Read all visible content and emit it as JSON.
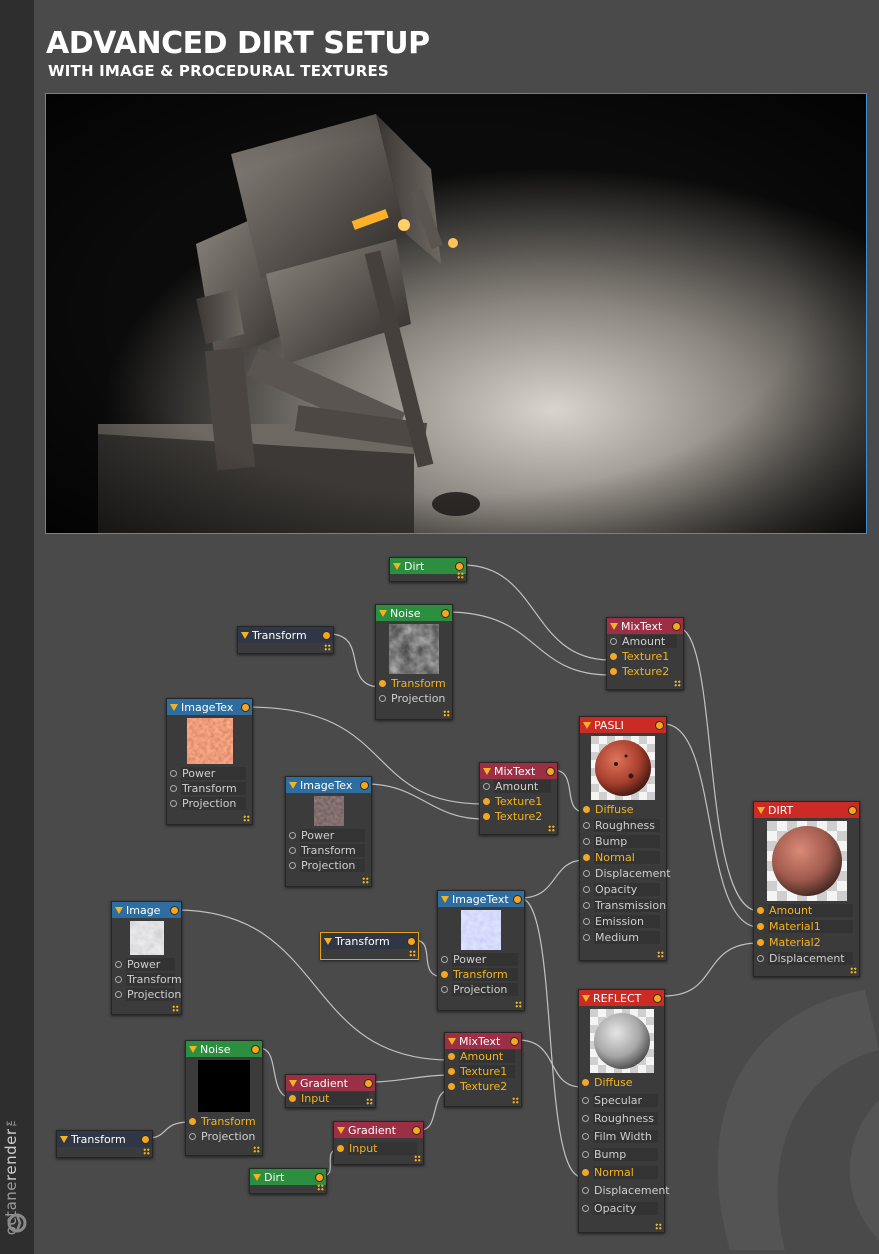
{
  "header": {
    "title": "ADVANCED DIRT SETUP",
    "subtitle": "WITH IMAGE & PROCEDURAL TEXTURES"
  },
  "brand": {
    "name_a": "octane",
    "name_b": "render",
    "mark": "™"
  },
  "colors": {
    "background": "#4a4a4a",
    "sidebar": "#2e2e2e",
    "wire": "#d8d8d8",
    "pin_active": "#f5a623",
    "header_green": "#2c8e3f",
    "header_blue": "#2d6da0",
    "header_navy": "#2f3645",
    "header_crimson": "#9c2e45",
    "header_red": "#cc2a24",
    "selection": "#e8a21a"
  },
  "nodes": {
    "dirt_top": {
      "title": "Dirt"
    },
    "noise_top": {
      "title": "Noise",
      "pins": [
        "Transform",
        "Projection"
      ]
    },
    "transform_top": {
      "title": "Transform"
    },
    "mixtext_top": {
      "title": "MixText",
      "pins": [
        "Amount",
        "Texture1",
        "Texture2"
      ]
    },
    "imagetex_a": {
      "title": "ImageTex",
      "pins": [
        "Power",
        "Transform",
        "Projection"
      ]
    },
    "imagetex_b": {
      "title": "ImageTex",
      "pins": [
        "Power",
        "Transform",
        "Projection"
      ]
    },
    "mixtext_mid": {
      "title": "MixText",
      "pins": [
        "Amount",
        "Texture1",
        "Texture2"
      ]
    },
    "pasli": {
      "title": "PASLI",
      "pins": [
        "Diffuse",
        "Roughness",
        "Bump",
        "Normal",
        "Displacement",
        "Opacity",
        "Transmission",
        "Emission",
        "Medium"
      ]
    },
    "dirt_mat": {
      "title": "DIRT",
      "pins": [
        "Amount",
        "Material1",
        "Material2",
        "Displacement"
      ]
    },
    "image": {
      "title": "Image",
      "pins": [
        "Power",
        "Transform",
        "Projection"
      ]
    },
    "transform_sel": {
      "title": "Transform"
    },
    "imagetext": {
      "title": "ImageText",
      "pins": [
        "Power",
        "Transform",
        "Projection"
      ]
    },
    "reflect": {
      "title": "REFLECT",
      "pins": [
        "Diffuse",
        "Specular",
        "Roughness",
        "Film Width",
        "Bump",
        "Normal",
        "Displacement",
        "Opacity"
      ]
    },
    "noise_bot": {
      "title": "Noise",
      "pins": [
        "Transform",
        "Projection"
      ]
    },
    "gradient_a": {
      "title": "Gradient",
      "pins": [
        "Input"
      ]
    },
    "mixtext_bot": {
      "title": "MixText",
      "pins": [
        "Amount",
        "Texture1",
        "Texture2"
      ]
    },
    "transform_bot": {
      "title": "Transform"
    },
    "gradient_b": {
      "title": "Gradient",
      "pins": [
        "Input"
      ]
    },
    "dirt_bot": {
      "title": "Dirt"
    }
  }
}
